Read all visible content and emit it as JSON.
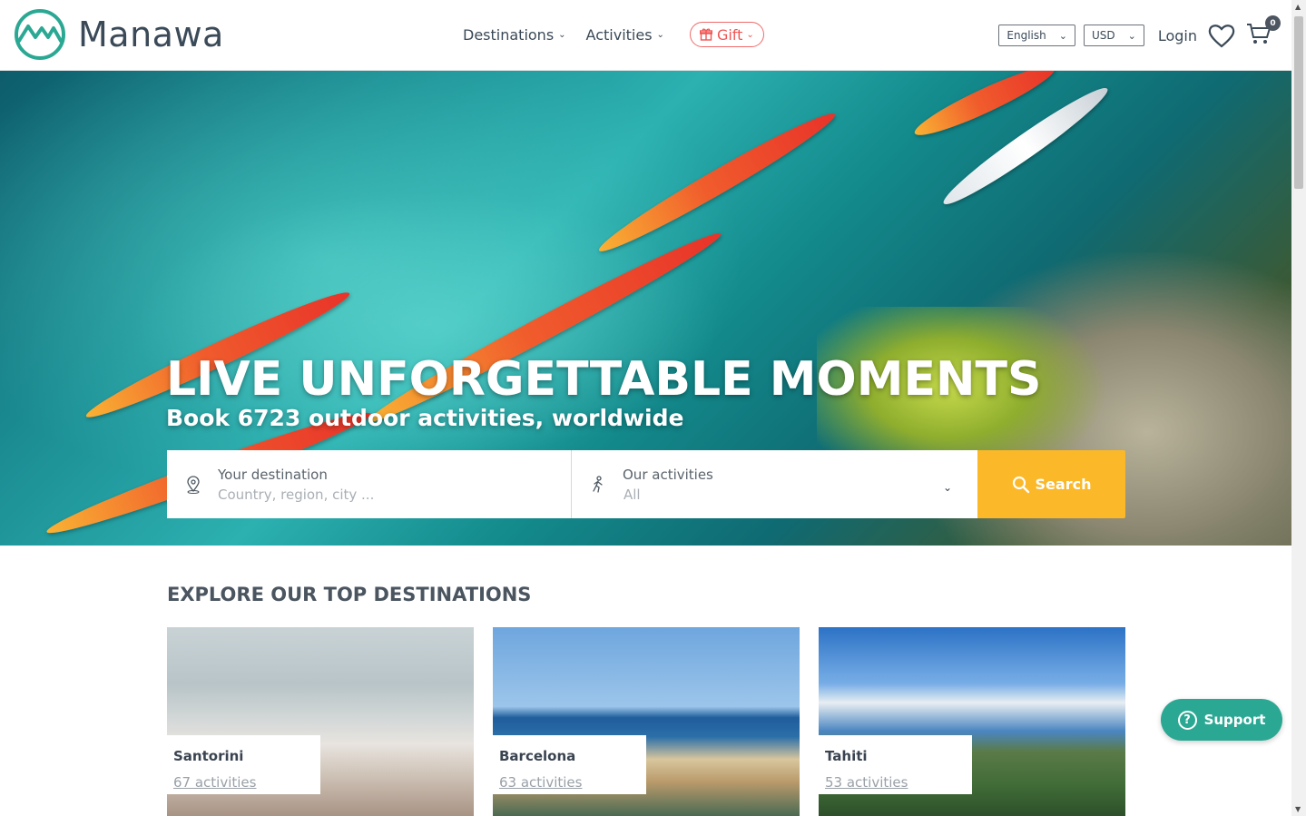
{
  "header": {
    "brand": "Manawa",
    "nav": [
      {
        "label": "Destinations"
      },
      {
        "label": "Activities"
      }
    ],
    "gift_label": "Gift",
    "language": "English",
    "currency": "USD",
    "login_label": "Login",
    "cart_count": "0"
  },
  "hero": {
    "title": "LIVE UNFORGETTABLE MOMENTS",
    "subtitle": "Book 6723 outdoor activities, worldwide",
    "destination_label": "Your destination",
    "destination_placeholder": "Country, region, city ...",
    "activities_label": "Our activities",
    "activities_value": "All",
    "search_label": "Search"
  },
  "destinations": {
    "title": "EXPLORE OUR TOP DESTINATIONS",
    "items": [
      {
        "name": "Santorini",
        "count": "67 activities"
      },
      {
        "name": "Barcelona",
        "count": "63 activities"
      },
      {
        "name": "Tahiti",
        "count": "53 activities"
      }
    ]
  },
  "support_label": "Support",
  "colors": {
    "brand_teal": "#2ba893",
    "accent_yellow": "#fbb829",
    "gift_red": "#f05555"
  }
}
